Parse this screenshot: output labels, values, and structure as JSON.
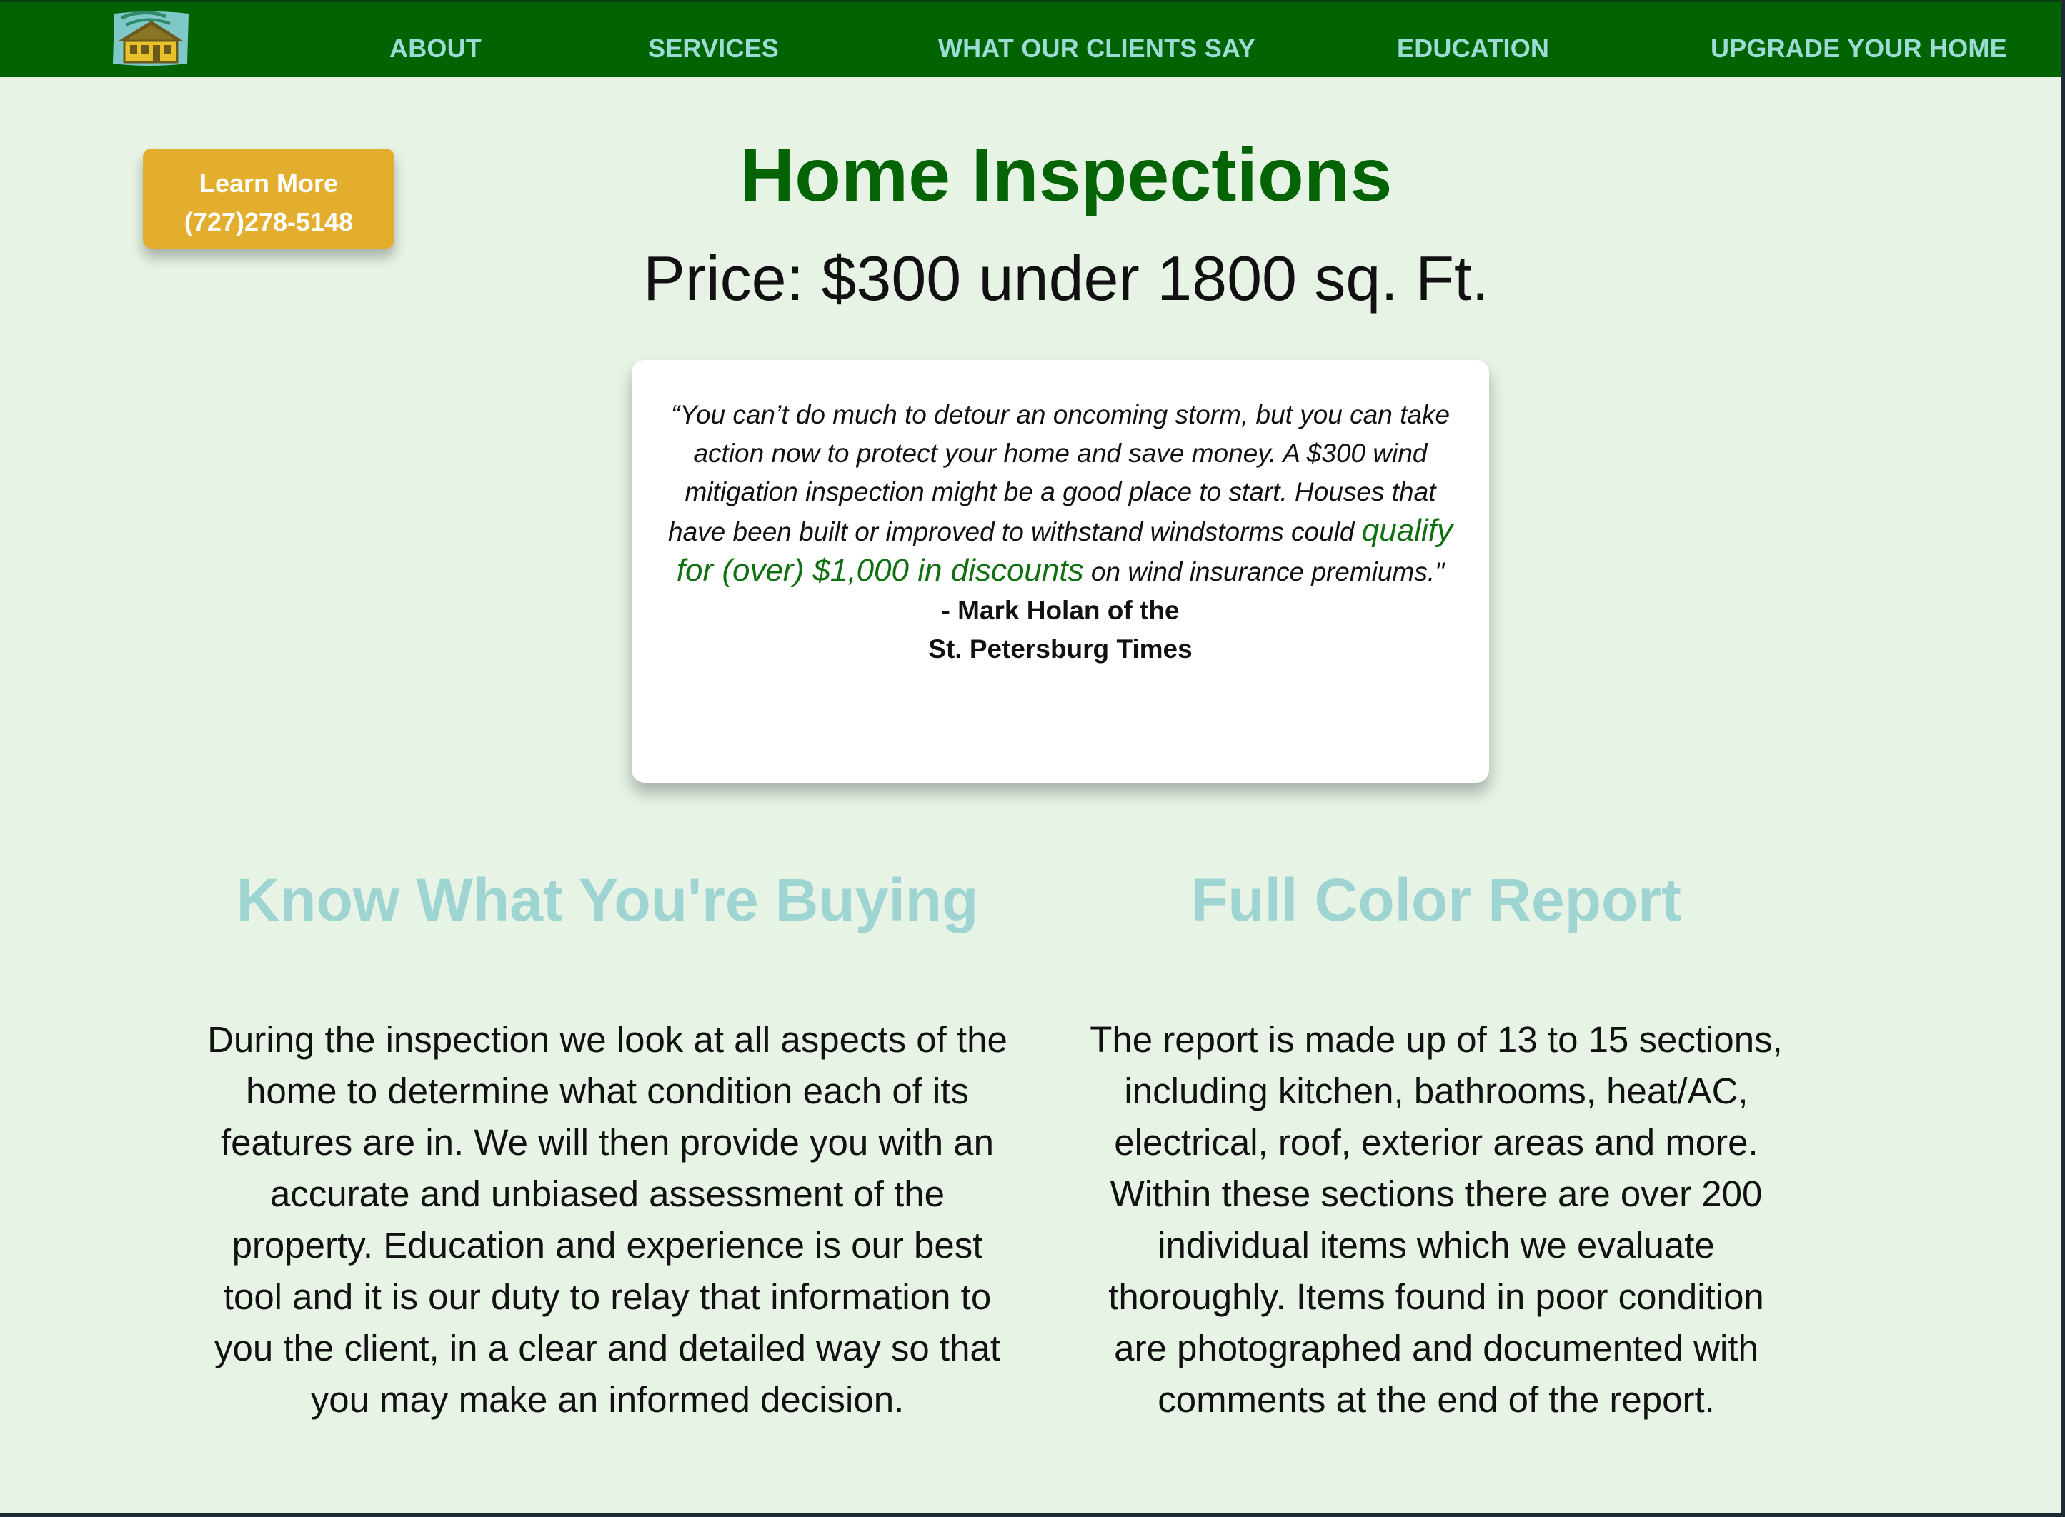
{
  "nav": {
    "logo_icon": "house-logo-icon",
    "links": [
      "ABOUT",
      "SERVICES",
      "WHAT OUR CLIENTS SAY",
      "EDUCATION",
      "UPGRADE YOUR HOME"
    ]
  },
  "cta": {
    "line1": "Learn More",
    "line2": "(727)278-5148"
  },
  "hero": {
    "title": "Home Inspections",
    "price": "Price: $300 under 1800 sq. Ft."
  },
  "quote": {
    "text_before": "“You can’t do much to detour an oncoming storm, but you can take action now to protect your home and save money. A $300 wind mitigation inspection might be a good place to start. Houses that have been built or improved to withstand windstorms could ",
    "highlight": "qualify for (over) $1,000 in discounts",
    "text_after": " on wind insurance premiums.\"",
    "author_line1": "- Mark Holan of the",
    "author_line2": "St. Petersburg Times"
  },
  "sections": [
    {
      "heading": "Know What You're Buying",
      "body": "During the inspection we look at all aspects of the home to determine what condition each of its features are in. We will then provide you with an accurate and unbiased assessment of the property. Education and experience is our best tool and it is our duty to relay that information to you the client, in a clear and detailed way so that you may make an informed decision."
    },
    {
      "heading": "Full Color Report",
      "body": "The report is made up of 13 to 15 sections, including kitchen, bathrooms, heat/AC, electrical, roof, exterior areas and more. Within these sections there are over 200 individual items which we evaluate thoroughly. Items found in poor condition are photographed and documented with comments at the end of the report."
    }
  ],
  "colors": {
    "nav_bg": "#026303",
    "nav_link": "#9ddbd5",
    "page_bg": "#e6f3e5",
    "cta_bg": "#e3ae2e",
    "title": "#036305",
    "section_heading": "#9ed4d2",
    "quote_highlight": "#106f10"
  }
}
